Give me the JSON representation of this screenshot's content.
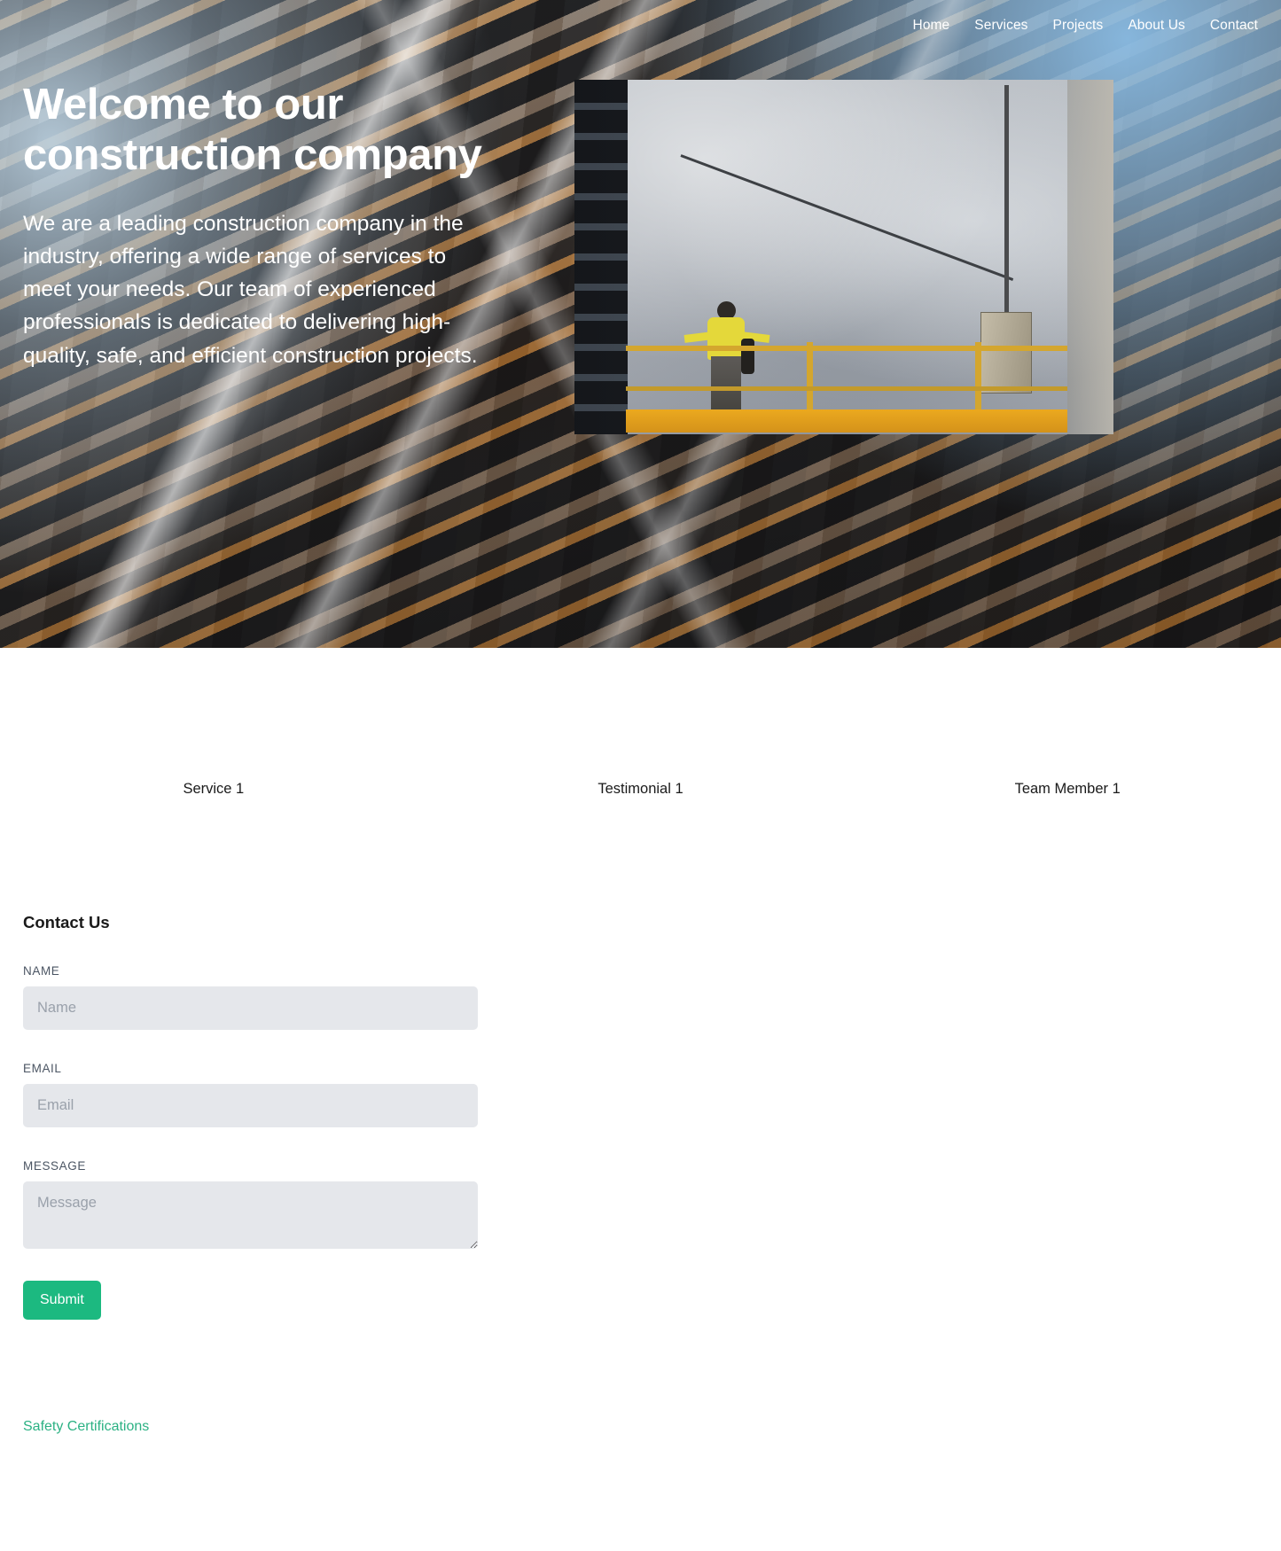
{
  "nav": {
    "items": [
      {
        "label": "Home"
      },
      {
        "label": "Services"
      },
      {
        "label": "Projects"
      },
      {
        "label": "About Us"
      },
      {
        "label": "Contact"
      }
    ]
  },
  "hero": {
    "title": "Welcome to our construction company",
    "text": "We are a leading construction company in the industry, offering a wide range of services to meet your needs. Our team of experienced professionals is dedicated to delivering high-quality, safe, and efficient construction projects.",
    "image_alt": "construction-worker-on-suspended-platform"
  },
  "cards": [
    {
      "label": "Service 1"
    },
    {
      "label": "Testimonial 1"
    },
    {
      "label": "Team Member 1"
    }
  ],
  "contact": {
    "heading": "Contact Us",
    "fields": [
      {
        "label": "NAME",
        "placeholder": "Name",
        "value": ""
      },
      {
        "label": "EMAIL",
        "placeholder": "Email",
        "value": ""
      },
      {
        "label": "MESSAGE",
        "placeholder": "Message",
        "value": ""
      }
    ],
    "submit_label": "Submit"
  },
  "footer": {
    "link_label": "Safety Certifications"
  },
  "colors": {
    "accent_green": "#1cb980",
    "link_green": "#2bb183",
    "input_bg": "#e5e7eb",
    "text_dark": "#1a1a1a",
    "label_gray": "#4b5563"
  }
}
